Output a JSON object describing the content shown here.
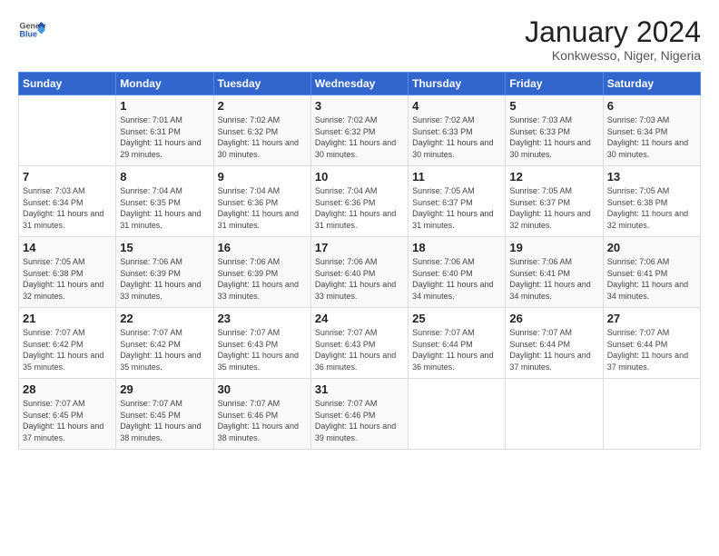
{
  "logo": {
    "general": "General",
    "blue": "Blue"
  },
  "header": {
    "title": "January 2024",
    "subtitle": "Konkwesso, Niger, Nigeria"
  },
  "weekdays": [
    "Sunday",
    "Monday",
    "Tuesday",
    "Wednesday",
    "Thursday",
    "Friday",
    "Saturday"
  ],
  "weeks": [
    [
      {
        "day": "",
        "sunrise": "",
        "sunset": "",
        "daylight": ""
      },
      {
        "day": "1",
        "sunrise": "Sunrise: 7:01 AM",
        "sunset": "Sunset: 6:31 PM",
        "daylight": "Daylight: 11 hours and 29 minutes."
      },
      {
        "day": "2",
        "sunrise": "Sunrise: 7:02 AM",
        "sunset": "Sunset: 6:32 PM",
        "daylight": "Daylight: 11 hours and 30 minutes."
      },
      {
        "day": "3",
        "sunrise": "Sunrise: 7:02 AM",
        "sunset": "Sunset: 6:32 PM",
        "daylight": "Daylight: 11 hours and 30 minutes."
      },
      {
        "day": "4",
        "sunrise": "Sunrise: 7:02 AM",
        "sunset": "Sunset: 6:33 PM",
        "daylight": "Daylight: 11 hours and 30 minutes."
      },
      {
        "day": "5",
        "sunrise": "Sunrise: 7:03 AM",
        "sunset": "Sunset: 6:33 PM",
        "daylight": "Daylight: 11 hours and 30 minutes."
      },
      {
        "day": "6",
        "sunrise": "Sunrise: 7:03 AM",
        "sunset": "Sunset: 6:34 PM",
        "daylight": "Daylight: 11 hours and 30 minutes."
      }
    ],
    [
      {
        "day": "7",
        "sunrise": "Sunrise: 7:03 AM",
        "sunset": "Sunset: 6:34 PM",
        "daylight": "Daylight: 11 hours and 31 minutes."
      },
      {
        "day": "8",
        "sunrise": "Sunrise: 7:04 AM",
        "sunset": "Sunset: 6:35 PM",
        "daylight": "Daylight: 11 hours and 31 minutes."
      },
      {
        "day": "9",
        "sunrise": "Sunrise: 7:04 AM",
        "sunset": "Sunset: 6:36 PM",
        "daylight": "Daylight: 11 hours and 31 minutes."
      },
      {
        "day": "10",
        "sunrise": "Sunrise: 7:04 AM",
        "sunset": "Sunset: 6:36 PM",
        "daylight": "Daylight: 11 hours and 31 minutes."
      },
      {
        "day": "11",
        "sunrise": "Sunrise: 7:05 AM",
        "sunset": "Sunset: 6:37 PM",
        "daylight": "Daylight: 11 hours and 31 minutes."
      },
      {
        "day": "12",
        "sunrise": "Sunrise: 7:05 AM",
        "sunset": "Sunset: 6:37 PM",
        "daylight": "Daylight: 11 hours and 32 minutes."
      },
      {
        "day": "13",
        "sunrise": "Sunrise: 7:05 AM",
        "sunset": "Sunset: 6:38 PM",
        "daylight": "Daylight: 11 hours and 32 minutes."
      }
    ],
    [
      {
        "day": "14",
        "sunrise": "Sunrise: 7:05 AM",
        "sunset": "Sunset: 6:38 PM",
        "daylight": "Daylight: 11 hours and 32 minutes."
      },
      {
        "day": "15",
        "sunrise": "Sunrise: 7:06 AM",
        "sunset": "Sunset: 6:39 PM",
        "daylight": "Daylight: 11 hours and 33 minutes."
      },
      {
        "day": "16",
        "sunrise": "Sunrise: 7:06 AM",
        "sunset": "Sunset: 6:39 PM",
        "daylight": "Daylight: 11 hours and 33 minutes."
      },
      {
        "day": "17",
        "sunrise": "Sunrise: 7:06 AM",
        "sunset": "Sunset: 6:40 PM",
        "daylight": "Daylight: 11 hours and 33 minutes."
      },
      {
        "day": "18",
        "sunrise": "Sunrise: 7:06 AM",
        "sunset": "Sunset: 6:40 PM",
        "daylight": "Daylight: 11 hours and 34 minutes."
      },
      {
        "day": "19",
        "sunrise": "Sunrise: 7:06 AM",
        "sunset": "Sunset: 6:41 PM",
        "daylight": "Daylight: 11 hours and 34 minutes."
      },
      {
        "day": "20",
        "sunrise": "Sunrise: 7:06 AM",
        "sunset": "Sunset: 6:41 PM",
        "daylight": "Daylight: 11 hours and 34 minutes."
      }
    ],
    [
      {
        "day": "21",
        "sunrise": "Sunrise: 7:07 AM",
        "sunset": "Sunset: 6:42 PM",
        "daylight": "Daylight: 11 hours and 35 minutes."
      },
      {
        "day": "22",
        "sunrise": "Sunrise: 7:07 AM",
        "sunset": "Sunset: 6:42 PM",
        "daylight": "Daylight: 11 hours and 35 minutes."
      },
      {
        "day": "23",
        "sunrise": "Sunrise: 7:07 AM",
        "sunset": "Sunset: 6:43 PM",
        "daylight": "Daylight: 11 hours and 35 minutes."
      },
      {
        "day": "24",
        "sunrise": "Sunrise: 7:07 AM",
        "sunset": "Sunset: 6:43 PM",
        "daylight": "Daylight: 11 hours and 36 minutes."
      },
      {
        "day": "25",
        "sunrise": "Sunrise: 7:07 AM",
        "sunset": "Sunset: 6:44 PM",
        "daylight": "Daylight: 11 hours and 36 minutes."
      },
      {
        "day": "26",
        "sunrise": "Sunrise: 7:07 AM",
        "sunset": "Sunset: 6:44 PM",
        "daylight": "Daylight: 11 hours and 37 minutes."
      },
      {
        "day": "27",
        "sunrise": "Sunrise: 7:07 AM",
        "sunset": "Sunset: 6:44 PM",
        "daylight": "Daylight: 11 hours and 37 minutes."
      }
    ],
    [
      {
        "day": "28",
        "sunrise": "Sunrise: 7:07 AM",
        "sunset": "Sunset: 6:45 PM",
        "daylight": "Daylight: 11 hours and 37 minutes."
      },
      {
        "day": "29",
        "sunrise": "Sunrise: 7:07 AM",
        "sunset": "Sunset: 6:45 PM",
        "daylight": "Daylight: 11 hours and 38 minutes."
      },
      {
        "day": "30",
        "sunrise": "Sunrise: 7:07 AM",
        "sunset": "Sunset: 6:46 PM",
        "daylight": "Daylight: 11 hours and 38 minutes."
      },
      {
        "day": "31",
        "sunrise": "Sunrise: 7:07 AM",
        "sunset": "Sunset: 6:46 PM",
        "daylight": "Daylight: 11 hours and 39 minutes."
      },
      {
        "day": "",
        "sunrise": "",
        "sunset": "",
        "daylight": ""
      },
      {
        "day": "",
        "sunrise": "",
        "sunset": "",
        "daylight": ""
      },
      {
        "day": "",
        "sunrise": "",
        "sunset": "",
        "daylight": ""
      }
    ]
  ]
}
